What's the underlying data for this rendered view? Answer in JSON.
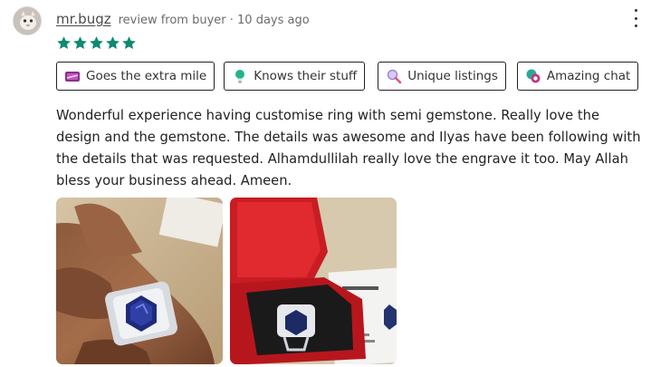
{
  "review": {
    "username": "mr.bugz",
    "meta": "review from buyer · 10 days ago",
    "rating": 5,
    "rating_color": "#0e8a6e",
    "tags": [
      {
        "label": "Goes the extra mile",
        "icon": "gift-card-icon"
      },
      {
        "label": "Knows their stuff",
        "icon": "lightbulb-icon"
      },
      {
        "label": "Unique listings",
        "icon": "magnifier-icon"
      },
      {
        "label": "Amazing chat",
        "icon": "chat-bubbles-icon"
      }
    ],
    "text": "Wonderful experience having customise ring with semi gemstone. Really love the design and the gemstone. The details was awesome and Ilyas have been following with the details that was requested. Alhamdullilah really love the engrave it too. May Allah bless your business ahead. Ameen.",
    "photos": [
      {
        "description": "ring-on-hand-photo"
      },
      {
        "description": "ring-in-red-box-photo"
      }
    ]
  }
}
